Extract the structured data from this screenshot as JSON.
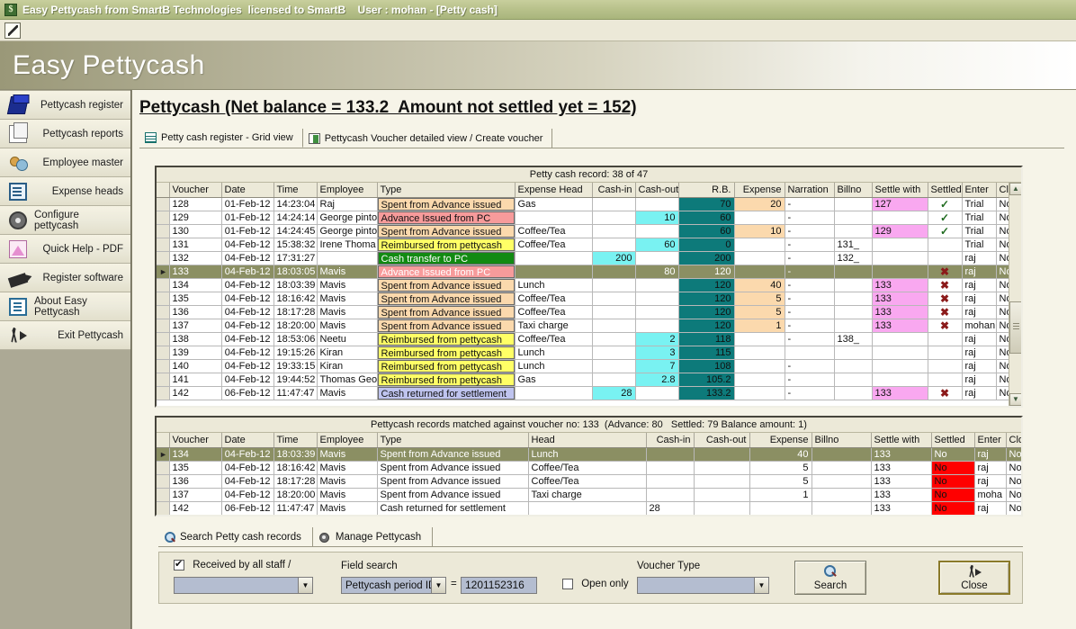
{
  "window": {
    "title": "Easy Pettycash from SmartB Technologies  licensed to SmartB    User : mohan - [Petty cash]",
    "app_icon": "$",
    "toolbar_icon": "checklist-icon"
  },
  "banner": {
    "text": "Easy Pettycash"
  },
  "sidebar": {
    "items": [
      {
        "label": "Pettycash register",
        "icon": "book-icon"
      },
      {
        "label": "Pettycash reports",
        "icon": "documents-icon"
      },
      {
        "label": "Employee master",
        "icon": "people-icon"
      },
      {
        "label": "Expense heads",
        "icon": "list-icon"
      },
      {
        "label": "Configure pettycash",
        "icon": "gear-icon"
      },
      {
        "label": "Quick Help - PDF",
        "icon": "pdf-icon"
      },
      {
        "label": "Register software",
        "icon": "register-icon"
      },
      {
        "label": "About Easy Pettycash",
        "icon": "about-icon"
      },
      {
        "label": "Exit  Pettycash",
        "icon": "exit-icon"
      }
    ]
  },
  "main": {
    "page_title": "Pettycash (Net balance = 133.2  Amount not settled yet = 152)",
    "tabs": [
      {
        "label": "Petty cash register - Grid view",
        "icon": "grid-icon",
        "active": true
      },
      {
        "label": "Pettycash Voucher detailed view / Create voucher",
        "icon": "voucher-icon",
        "active": false
      }
    ]
  },
  "grid1": {
    "caption": "Petty cash record: 38 of 47",
    "columns": [
      "Voucher",
      "Date",
      "Time",
      "Employee",
      "Type",
      "Expense Head",
      "Cash-in",
      "Cash-out",
      "R.B.",
      "Expense",
      "Narration",
      "Billno",
      "Settle with",
      "Settled",
      "Enter",
      "Closed"
    ],
    "rows": [
      {
        "voucher": "128",
        "date": "01-Feb-12",
        "time": "14:23:04",
        "employee": "Raj",
        "type": "Spent from Advance issued",
        "type_kind": "spent",
        "head": "Gas",
        "cashin": "",
        "cashout": "",
        "rb": "70",
        "expense": "20",
        "narration": "-",
        "billno": "",
        "settle": "127",
        "settled": "yes",
        "enter": "Trial",
        "closed": "No",
        "selected": false
      },
      {
        "voucher": "129",
        "date": "01-Feb-12",
        "time": "14:24:14",
        "employee": "George pinto",
        "type": "Advance Issued from PC",
        "type_kind": "advance",
        "head": "",
        "cashin": "",
        "cashout": "10",
        "rb": "60",
        "expense": "",
        "narration": "-",
        "billno": "",
        "settle": "",
        "settled": "yes",
        "enter": "Trial",
        "closed": "No",
        "selected": false
      },
      {
        "voucher": "130",
        "date": "01-Feb-12",
        "time": "14:24:45",
        "employee": "George pinto",
        "type": "Spent from Advance issued",
        "type_kind": "spent",
        "head": "Coffee/Tea",
        "cashin": "",
        "cashout": "",
        "rb": "60",
        "expense": "10",
        "narration": "-",
        "billno": "",
        "settle": "129",
        "settled": "yes",
        "enter": "Trial",
        "closed": "No",
        "selected": false
      },
      {
        "voucher": "131",
        "date": "04-Feb-12",
        "time": "15:38:32",
        "employee": "Irene Thoma",
        "type": "Reimbursed from pettycash",
        "type_kind": "reimb",
        "head": "Coffee/Tea",
        "cashin": "",
        "cashout": "60",
        "rb": "0",
        "expense": "",
        "narration": "-",
        "billno": "131_",
        "settle": "",
        "settled": "",
        "enter": "Trial",
        "closed": "No",
        "selected": false
      },
      {
        "voucher": "132",
        "date": "04-Feb-12",
        "time": "17:31:27",
        "employee": "",
        "type": "Cash transfer to PC",
        "type_kind": "transfer",
        "head": "",
        "cashin": "200",
        "cashout": "",
        "rb": "200",
        "expense": "",
        "narration": "-",
        "billno": "132_",
        "settle": "",
        "settled": "",
        "enter": "raj",
        "closed": "No",
        "selected": false
      },
      {
        "voucher": "133",
        "date": "04-Feb-12",
        "time": "18:03:05",
        "employee": "Mavis",
        "type": "Advance Issued from PC",
        "type_kind": "advance",
        "head": "",
        "cashin": "",
        "cashout": "80",
        "rb": "120",
        "expense": "",
        "narration": "-",
        "billno": "",
        "settle": "",
        "settled": "no",
        "enter": "raj",
        "closed": "No",
        "selected": true
      },
      {
        "voucher": "134",
        "date": "04-Feb-12",
        "time": "18:03:39",
        "employee": "Mavis",
        "type": "Spent from Advance issued",
        "type_kind": "spent",
        "head": "Lunch",
        "cashin": "",
        "cashout": "",
        "rb": "120",
        "expense": "40",
        "narration": "-",
        "billno": "",
        "settle": "133",
        "settled": "no",
        "enter": "raj",
        "closed": "No",
        "selected": false
      },
      {
        "voucher": "135",
        "date": "04-Feb-12",
        "time": "18:16:42",
        "employee": "Mavis",
        "type": "Spent from Advance issued",
        "type_kind": "spent",
        "head": "Coffee/Tea",
        "cashin": "",
        "cashout": "",
        "rb": "120",
        "expense": "5",
        "narration": "-",
        "billno": "",
        "settle": "133",
        "settled": "no",
        "enter": "raj",
        "closed": "No",
        "selected": false
      },
      {
        "voucher": "136",
        "date": "04-Feb-12",
        "time": "18:17:28",
        "employee": "Mavis",
        "type": "Spent from Advance issued",
        "type_kind": "spent",
        "head": "Coffee/Tea",
        "cashin": "",
        "cashout": "",
        "rb": "120",
        "expense": "5",
        "narration": "-",
        "billno": "",
        "settle": "133",
        "settled": "no",
        "enter": "raj",
        "closed": "No",
        "selected": false
      },
      {
        "voucher": "137",
        "date": "04-Feb-12",
        "time": "18:20:00",
        "employee": "Mavis",
        "type": "Spent from Advance issued",
        "type_kind": "spent",
        "head": "Taxi charge",
        "cashin": "",
        "cashout": "",
        "rb": "120",
        "expense": "1",
        "narration": "-",
        "billno": "",
        "settle": "133",
        "settled": "no",
        "enter": "mohan",
        "closed": "No",
        "selected": false
      },
      {
        "voucher": "138",
        "date": "04-Feb-12",
        "time": "18:53:06",
        "employee": "Neetu",
        "type": "Reimbursed from pettycash",
        "type_kind": "reimb",
        "head": "Coffee/Tea",
        "cashin": "",
        "cashout": "2",
        "rb": "118",
        "expense": "",
        "narration": "-",
        "billno": "138_",
        "settle": "",
        "settled": "",
        "enter": "raj",
        "closed": "No",
        "selected": false
      },
      {
        "voucher": "139",
        "date": "04-Feb-12",
        "time": "19:15:26",
        "employee": "Kiran",
        "type": "Reimbursed from pettycash",
        "type_kind": "reimb",
        "head": "Lunch",
        "cashin": "",
        "cashout": "3",
        "rb": "115",
        "expense": "",
        "narration": "",
        "billno": "",
        "settle": "",
        "settled": "",
        "enter": "raj",
        "closed": "No",
        "selected": false
      },
      {
        "voucher": "140",
        "date": "04-Feb-12",
        "time": "19:33:15",
        "employee": "Kiran",
        "type": "Reimbursed from pettycash",
        "type_kind": "reimb",
        "head": "Lunch",
        "cashin": "",
        "cashout": "7",
        "rb": "108",
        "expense": "",
        "narration": "-",
        "billno": "",
        "settle": "",
        "settled": "",
        "enter": "raj",
        "closed": "No",
        "selected": false
      },
      {
        "voucher": "141",
        "date": "04-Feb-12",
        "time": "19:44:52",
        "employee": "Thomas Geo",
        "type": "Reimbursed from pettycash",
        "type_kind": "reimb",
        "head": "Gas",
        "cashin": "",
        "cashout": "2.8",
        "rb": "105.2",
        "expense": "",
        "narration": "-",
        "billno": "",
        "settle": "",
        "settled": "",
        "enter": "raj",
        "closed": "No",
        "selected": false
      },
      {
        "voucher": "142",
        "date": "06-Feb-12",
        "time": "11:47:47",
        "employee": "Mavis",
        "type": "Cash returned for settlement",
        "type_kind": "return",
        "head": "",
        "cashin": "28",
        "cashout": "",
        "rb": "133.2",
        "expense": "",
        "narration": "-",
        "billno": "",
        "settle": "133",
        "settled": "no",
        "enter": "raj",
        "closed": "No",
        "selected": false
      }
    ]
  },
  "grid2": {
    "caption": "Pettycash records matched against voucher no: 133  (Advance: 80   Settled: 79 Balance amount: 1)",
    "columns": [
      "Voucher",
      "Date",
      "Time",
      "Employee",
      "Type",
      "Head",
      "Cash-in",
      "Cash-out",
      "Expense",
      "Billno",
      "Settle with",
      "Settled",
      "Enter",
      "Closed"
    ],
    "rows": [
      {
        "voucher": "134",
        "date": "04-Feb-12",
        "time": "18:03:39",
        "employee": "Mavis",
        "type": "Spent from Advance issued",
        "head": "Lunch",
        "cashin": "",
        "cashout": "",
        "expense": "40",
        "billno": "",
        "settle": "133",
        "settled": "No",
        "enter": "raj",
        "closed": "No",
        "selected": true
      },
      {
        "voucher": "135",
        "date": "04-Feb-12",
        "time": "18:16:42",
        "employee": "Mavis",
        "type": "Spent from Advance issued",
        "head": "Coffee/Tea",
        "cashin": "",
        "cashout": "",
        "expense": "5",
        "billno": "",
        "settle": "133",
        "settled": "No",
        "enter": "raj",
        "closed": "No",
        "selected": false
      },
      {
        "voucher": "136",
        "date": "04-Feb-12",
        "time": "18:17:28",
        "employee": "Mavis",
        "type": "Spent from Advance issued",
        "head": "Coffee/Tea",
        "cashin": "",
        "cashout": "",
        "expense": "5",
        "billno": "",
        "settle": "133",
        "settled": "No",
        "enter": "raj",
        "closed": "No",
        "selected": false
      },
      {
        "voucher": "137",
        "date": "04-Feb-12",
        "time": "18:20:00",
        "employee": "Mavis",
        "type": "Spent from Advance issued",
        "head": "Taxi charge",
        "cashin": "",
        "cashout": "",
        "expense": "1",
        "billno": "",
        "settle": "133",
        "settled": "No",
        "enter": "moha",
        "closed": "No",
        "selected": false
      },
      {
        "voucher": "142",
        "date": "06-Feb-12",
        "time": "11:47:47",
        "employee": "Mavis",
        "type": "Cash returned for settlement",
        "head": "",
        "cashin": "28",
        "cashout": "",
        "expense": "",
        "billno": "",
        "settle": "133",
        "settled": "No",
        "enter": "raj",
        "closed": "No",
        "selected": false
      }
    ]
  },
  "bottom_tabs": [
    {
      "label": "Search Petty cash records",
      "icon": "magnifier-icon"
    },
    {
      "label": "Manage Pettycash",
      "icon": "gear-icon"
    }
  ],
  "search_panel": {
    "received_by_label": "Received by all staff /",
    "received_by_checked": true,
    "staff_value": "",
    "field_search_label": "Field search",
    "field_search_value": "Pettycash period ID",
    "equals_sign": "=",
    "field_value": "1201152316",
    "open_only_label": "Open only",
    "open_only_checked": false,
    "voucher_type_label": "Voucher Type",
    "voucher_type_value": "",
    "search_button": "Search",
    "close_button": "Close"
  },
  "colors": {
    "spent": "#fbd9ad",
    "advance": "#f79b9b",
    "reimbursed": "#ffff66",
    "transfer": "#128a12",
    "returned": "#bfc4ef",
    "cash": "#79f2f2",
    "running_balance": "#0d7a7a",
    "settle_with": "#f9a8f0",
    "not_settled": "#ff0000",
    "selection": "#8b8f63"
  }
}
